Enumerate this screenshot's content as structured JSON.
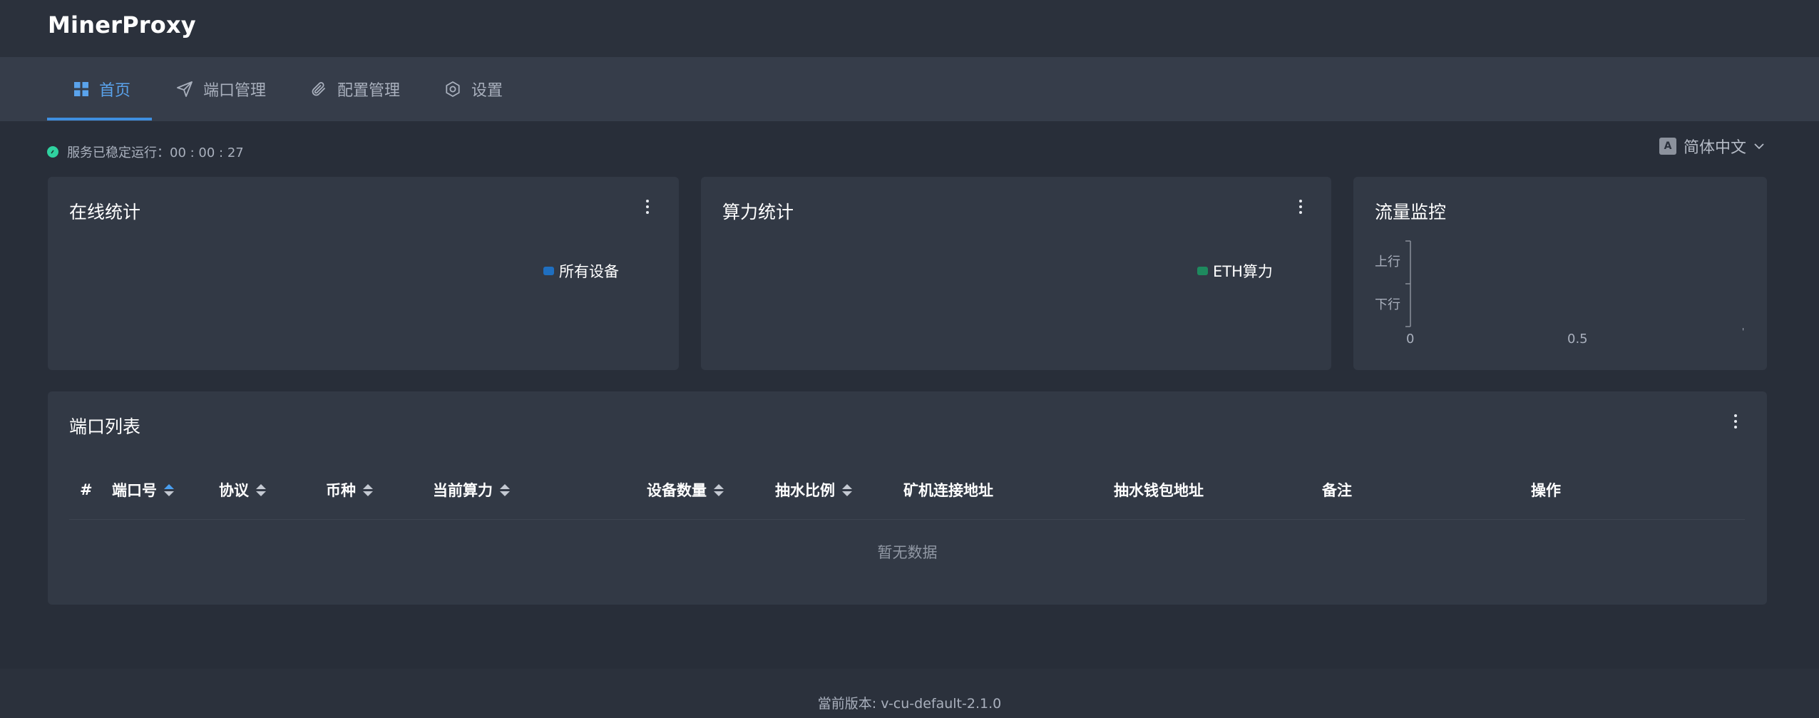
{
  "app": {
    "title": "MinerProxy"
  },
  "nav": {
    "items": [
      {
        "label": "首页",
        "icon": "grid-icon"
      },
      {
        "label": "端口管理",
        "icon": "send-icon"
      },
      {
        "label": "配置管理",
        "icon": "paperclip-icon"
      },
      {
        "label": "设置",
        "icon": "gear-icon"
      }
    ],
    "active_index": 0,
    "language": {
      "label": "简体中文",
      "icon": "translate-icon"
    }
  },
  "status": {
    "text": "服务已稳定运行：00 : 00 : 27",
    "color": "#2fd2a0"
  },
  "cards": {
    "online": {
      "title": "在线统计",
      "legend": "所有设备",
      "legend_color": "#1f6fc0"
    },
    "hashrate": {
      "title": "算力统计",
      "legend": "ETH算力",
      "legend_color": "#1e8a5e"
    },
    "traffic": {
      "title": "流量监控"
    }
  },
  "chart_data": {
    "type": "bar",
    "title": "流量监控",
    "categories": [
      "上行",
      "下行"
    ],
    "values": [
      0,
      0
    ],
    "xlim": [
      0,
      1
    ],
    "x_ticks": [
      "0",
      "0.5",
      "'"
    ],
    "orientation": "horizontal"
  },
  "port_table": {
    "title": "端口列表",
    "columns": [
      "#",
      "端口号",
      "协议",
      "币种",
      "当前算力",
      "设备数量",
      "抽水比例",
      "矿机连接地址",
      "抽水钱包地址",
      "备注",
      "操作"
    ],
    "rows": [],
    "empty_text": "暂无数据"
  },
  "footer": {
    "version_text": "當前版本: v-cu-default-2.1.0"
  },
  "colors": {
    "accent": "#3f8fe0",
    "background": "#282e39",
    "card": "#323945"
  }
}
